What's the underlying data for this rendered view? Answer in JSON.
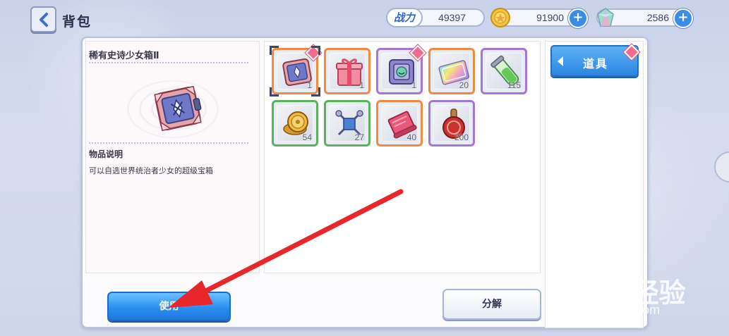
{
  "header": {
    "title": "背包",
    "power": {
      "label": "战力",
      "value": "49397"
    },
    "coins": {
      "value": "91900",
      "icon": "coin-icon"
    },
    "gems": {
      "value": "2586",
      "icon": "crystal-icon"
    }
  },
  "detail": {
    "item_name": "稀有史诗少女箱Ⅱ",
    "desc_title": "物品说明",
    "desc_text": "可以自选世界统治者少女的超级宝箱",
    "icon": "chest-icon"
  },
  "inventory": [
    {
      "icon": "chest-icon",
      "count": "1",
      "quality": "orange",
      "gem": true,
      "selected": true
    },
    {
      "icon": "gift-box-icon",
      "count": "1",
      "quality": "orange",
      "gem": false
    },
    {
      "icon": "smiley-box-icon",
      "count": "1",
      "quality": "purple",
      "gem": true
    },
    {
      "icon": "ticket-icon",
      "count": "20",
      "quality": "orange",
      "gem": false
    },
    {
      "icon": "potion-tube-icon",
      "count": "115",
      "quality": "purple",
      "gem": false
    },
    {
      "icon": "gold-coins-icon",
      "count": "54",
      "quality": "green",
      "gem": false
    },
    {
      "icon": "crossed-keys-icon",
      "count": "27",
      "quality": "green",
      "gem": false
    },
    {
      "icon": "scroll-icon",
      "count": "40",
      "quality": "orange",
      "gem": false
    },
    {
      "icon": "seal-stamp-icon",
      "count": "200",
      "quality": "purple",
      "gem": false
    }
  ],
  "side_tab": {
    "label": "道具"
  },
  "buttons": {
    "use": "使用",
    "split": "分解"
  },
  "watermark": {
    "line1": "Baidu经验",
    "line2": "jingyan.baidu.com"
  },
  "colors": {
    "orange": "#ef8a43",
    "purple": "#a476d6",
    "green": "#5ab25a",
    "accent": "#2b8ff0",
    "arrow": "#e8262b"
  }
}
